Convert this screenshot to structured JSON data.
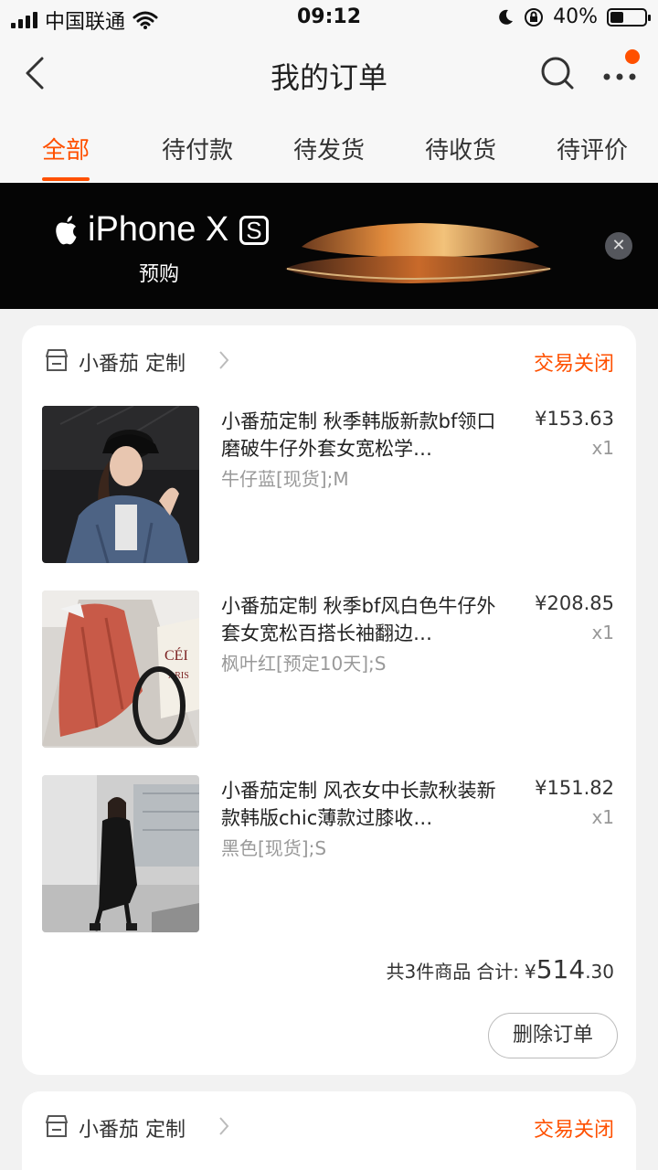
{
  "status_bar": {
    "carrier": "中国联通",
    "time": "09:12",
    "battery": "40%"
  },
  "nav": {
    "title": "我的订单"
  },
  "tabs": [
    {
      "label": "全部",
      "active": true
    },
    {
      "label": "待付款",
      "active": false
    },
    {
      "label": "待发货",
      "active": false
    },
    {
      "label": "待收货",
      "active": false
    },
    {
      "label": "待评价",
      "active": false
    }
  ],
  "banner": {
    "brand": "iPhone X",
    "badge": "S",
    "subtitle": "预购"
  },
  "orders": [
    {
      "shop_name": "小番茄 定制",
      "status": "交易关闭",
      "items": [
        {
          "title": "小番茄定制 秋季韩版新款bf领口磨破牛仔外套女宽松学…",
          "sku": "牛仔蓝[现货];M",
          "price": "¥153.63",
          "qty": "x1"
        },
        {
          "title": "小番茄定制 秋季bf风白色牛仔外套女宽松百搭长袖翻边…",
          "sku": "枫叶红[预定10天];S",
          "price": "¥208.85",
          "qty": "x1"
        },
        {
          "title": "小番茄定制 风衣女中长款秋装新款韩版chic薄款过膝收…",
          "sku": "黑色[现货];S",
          "price": "¥151.82",
          "qty": "x1"
        }
      ],
      "summary": {
        "count_text": "共3件商品",
        "total_label": "合计:",
        "currency": "¥",
        "total_int": "514",
        "total_dec": ".30"
      },
      "delete_label": "删除订单"
    },
    {
      "shop_name": "小番茄 定制",
      "status": "交易关闭"
    }
  ],
  "colors": {
    "accent": "#ff5000",
    "banner_bg": "#050505",
    "page_bg": "#f2f2f2"
  }
}
